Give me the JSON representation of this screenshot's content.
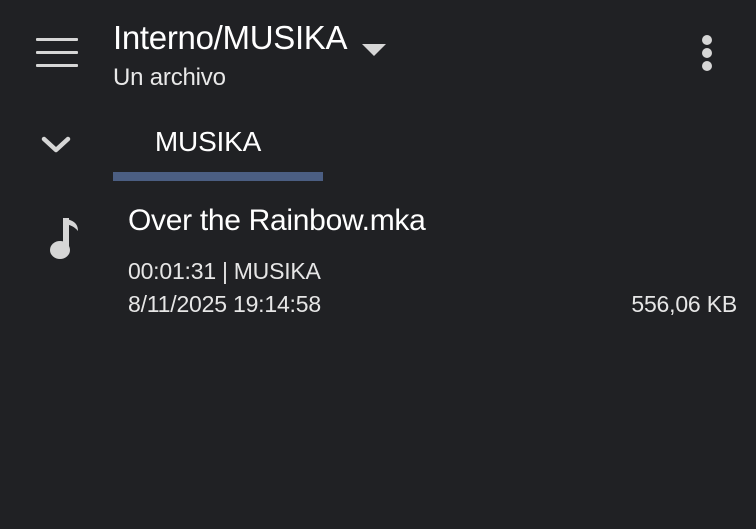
{
  "toolbar": {
    "menu_icon": "hamburger-menu-icon",
    "title": "Interno/MUSIKA",
    "dropdown_icon": "caret-down-icon",
    "subtitle": "Un archivo",
    "overflow_icon": "more-vert-icon"
  },
  "tabs": {
    "collapse_icon": "chevron-down-icon",
    "items": [
      {
        "label": "MUSIKA",
        "selected": true
      }
    ],
    "indicator_color": "#4b5e82"
  },
  "files": [
    {
      "icon": "music-note-icon",
      "name": "Over the Rainbow.mka",
      "duration": "00:01:31",
      "separator": "|",
      "folder": "MUSIKA",
      "date": "8/11/2025 19:14:58",
      "size": "556,06 KB"
    }
  ],
  "colors": {
    "background": "#202124",
    "text": "#ffffff",
    "icon": "#d6d6d6"
  }
}
